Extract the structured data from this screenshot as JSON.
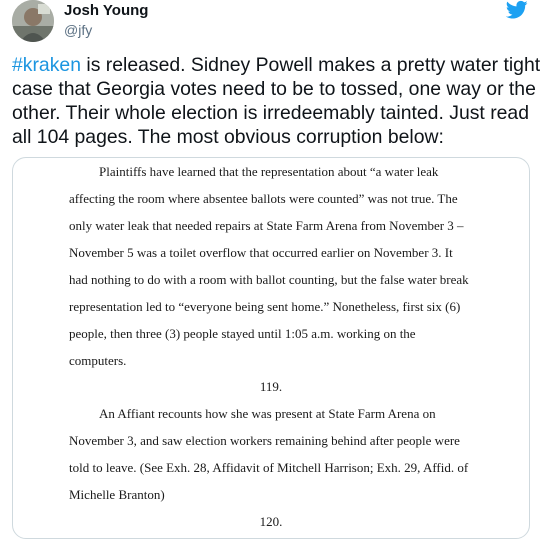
{
  "tweet": {
    "author": {
      "display_name": "Josh Young",
      "handle": "@jfy"
    },
    "brand": {
      "icon": "twitter-bird-icon",
      "color": "#1da1f2"
    },
    "hashtag": "#kraken",
    "text_lines": [
      " is released. Sidney Powell makes a pretty water tight",
      "case that Georgia votes need to be to tossed, one way or the",
      "other. Their whole election is irredeemably tainted. Just read",
      "all 104 pages. The most obvious corruption below:"
    ]
  },
  "document": {
    "paragraph_1": [
      "Plaintiffs have learned that the representation about “a water leak",
      "affecting the room where absentee ballots were counted” was not true. The",
      "only water leak that needed repairs at State Farm Arena from November 3 –",
      "November 5 was a toilet overflow that occurred earlier on November 3.  It",
      "had nothing to do with a room with ballot counting, but the false water break",
      "representation led to “everyone being sent home.”  Nonetheless, first six (6)",
      "people, then three (3) people stayed until 1:05 a.m. working on the",
      "computers."
    ],
    "page_119": "119.",
    "paragraph_2": [
      "An Affiant recounts how she was present at State Farm Arena on",
      "November 3, and saw election workers remaining behind after people were",
      "told to leave.  (See Exh. 28, Affidavit of Mitchell Harrison; Exh. 29, Affid. of",
      "Michelle Branton)"
    ],
    "page_120": "120."
  },
  "colors": {
    "hashtag": "#1b95e0",
    "text": "#0f1419",
    "muted": "#5b7083",
    "border": "#cfd9de"
  }
}
